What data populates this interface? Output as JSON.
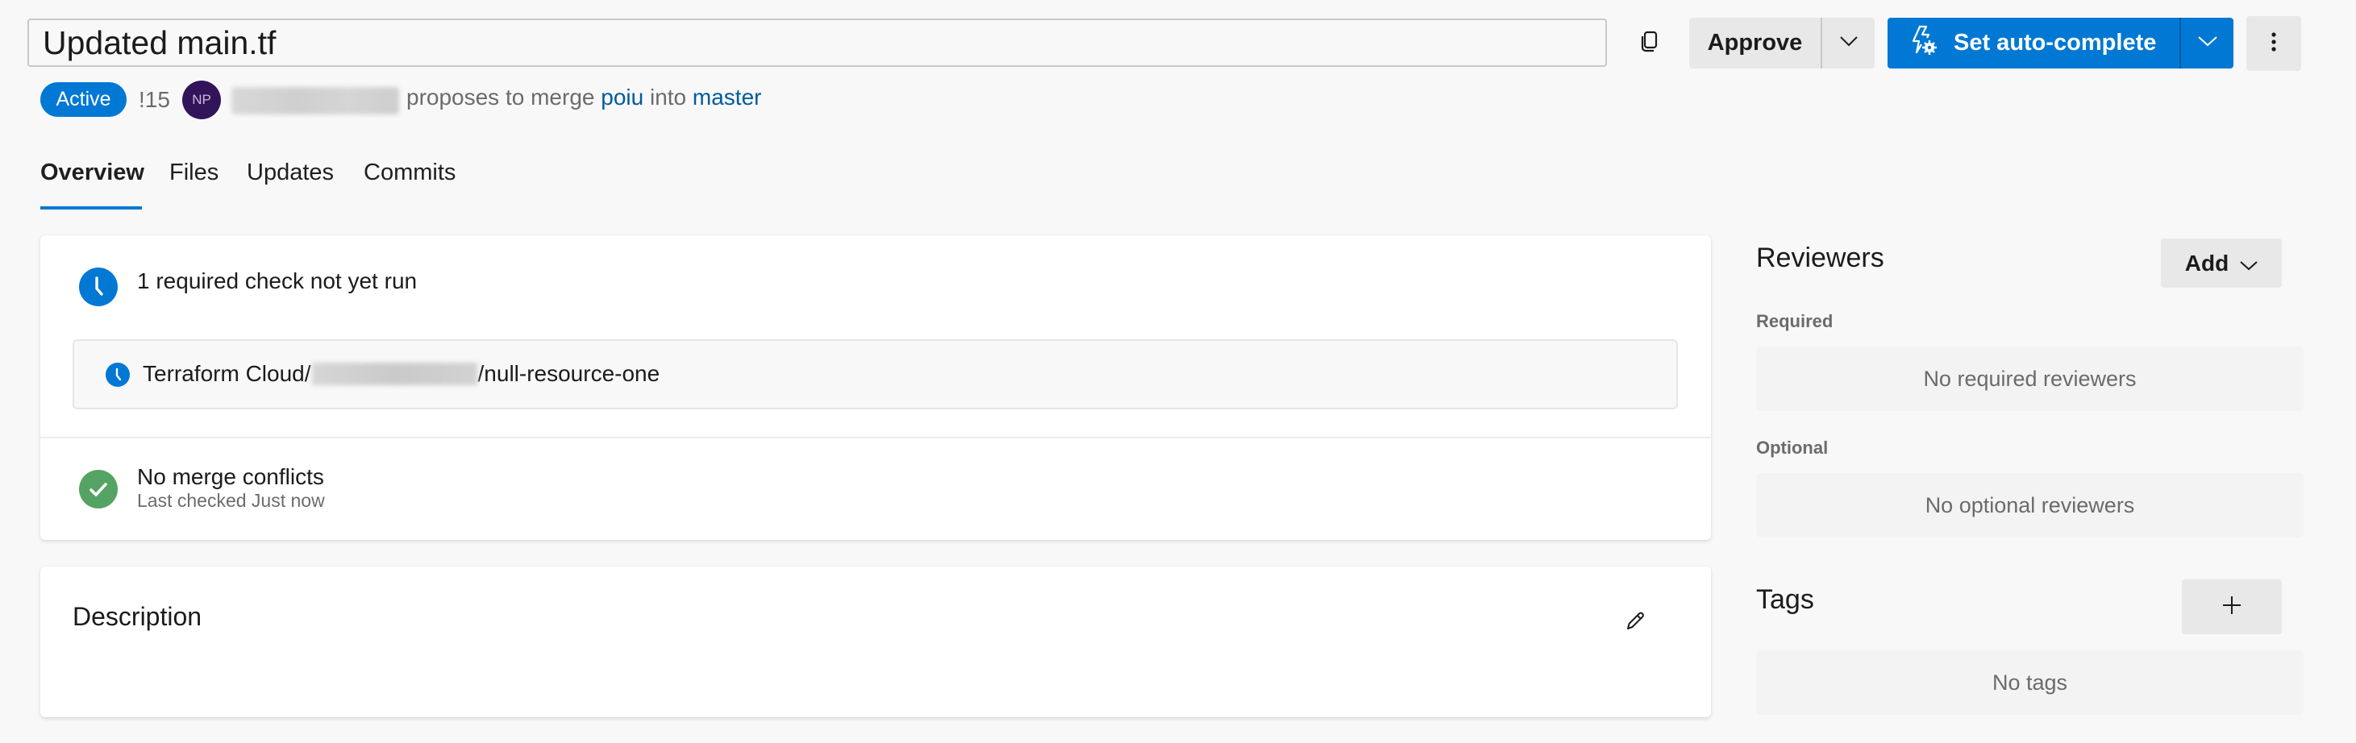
{
  "header": {
    "title_value": "Updated main.tf",
    "copy_icon": "copy-icon",
    "approve_label": "Approve",
    "approve_dropdown_icon": "chevron-down-icon",
    "autocomplete_label": "Set auto-complete",
    "autocomplete_icon": "flash-gear-icon",
    "autocomplete_dropdown_icon": "chevron-down-icon",
    "more_icon": "more-vertical-icon"
  },
  "meta": {
    "status": "Active",
    "pr_id": "!15",
    "author_initials": "NP",
    "author_name_redacted": true,
    "proposes_text": "proposes to merge",
    "source_branch": "poiu",
    "into_text": "into",
    "target_branch": "master"
  },
  "tabs": [
    {
      "label": "Overview",
      "active": true
    },
    {
      "label": "Files",
      "active": false
    },
    {
      "label": "Updates",
      "active": false
    },
    {
      "label": "Commits",
      "active": false
    }
  ],
  "checks": {
    "summary": "1 required check not yet run",
    "row_prefix": "Terraform Cloud/",
    "row_redacted": true,
    "row_suffix": "/null-resource-one",
    "merge_title": "No merge conflicts",
    "merge_subtitle": "Last checked Just now"
  },
  "description": {
    "title": "Description",
    "edit_icon": "pencil-icon"
  },
  "reviewers": {
    "title": "Reviewers",
    "add_label": "Add",
    "required_label": "Required",
    "required_empty": "No required reviewers",
    "optional_label": "Optional",
    "optional_empty": "No optional reviewers"
  },
  "tags": {
    "title": "Tags",
    "add_icon": "plus-icon",
    "empty": "No tags"
  },
  "colors": {
    "accent": "#0078d4",
    "link": "#005a9e",
    "success": "#55a362",
    "avatar_bg": "#32145a"
  }
}
